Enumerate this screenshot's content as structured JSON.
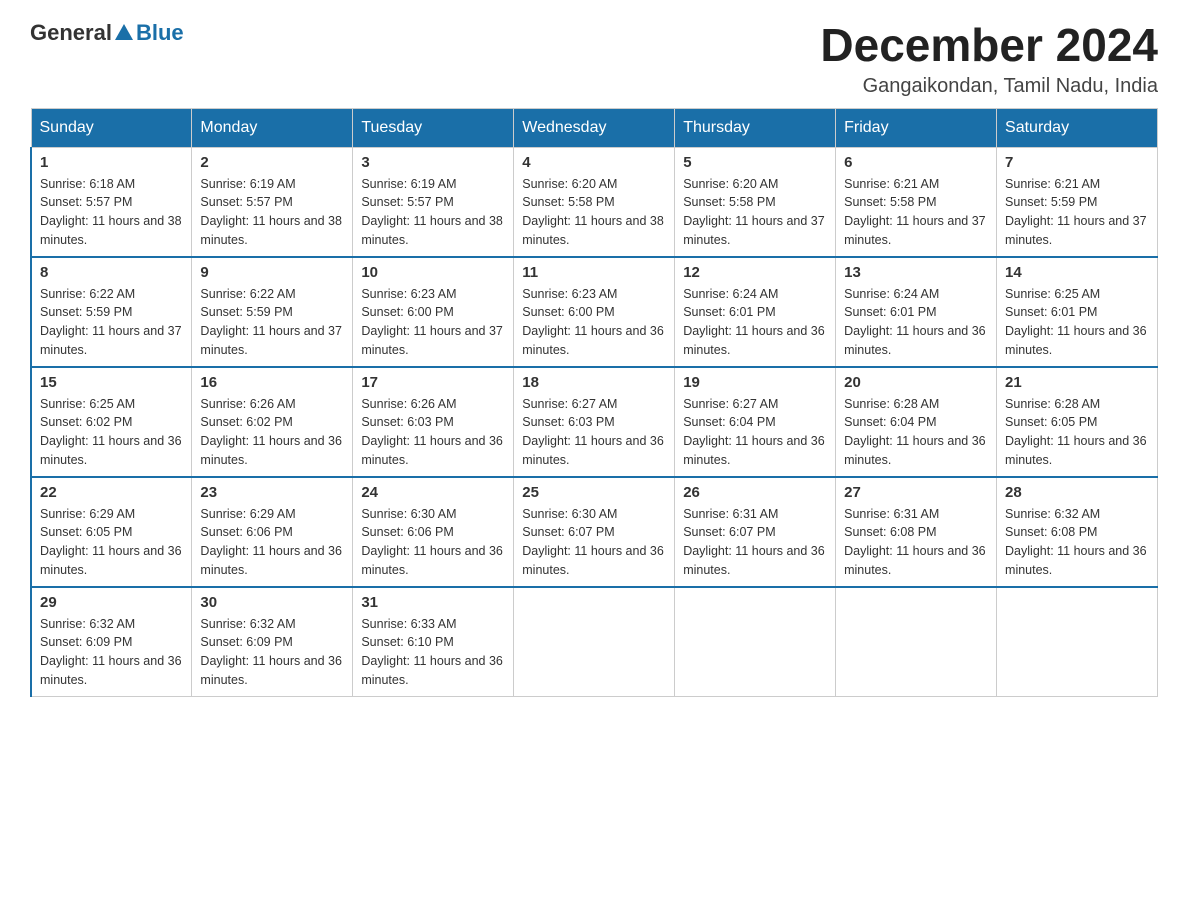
{
  "header": {
    "logo_general": "General",
    "logo_blue": "Blue",
    "title": "December 2024",
    "location": "Gangaikondan, Tamil Nadu, India"
  },
  "days_of_week": [
    "Sunday",
    "Monday",
    "Tuesday",
    "Wednesday",
    "Thursday",
    "Friday",
    "Saturday"
  ],
  "weeks": [
    [
      {
        "date": "1",
        "sunrise": "6:18 AM",
        "sunset": "5:57 PM",
        "daylight": "11 hours and 38 minutes."
      },
      {
        "date": "2",
        "sunrise": "6:19 AM",
        "sunset": "5:57 PM",
        "daylight": "11 hours and 38 minutes."
      },
      {
        "date": "3",
        "sunrise": "6:19 AM",
        "sunset": "5:57 PM",
        "daylight": "11 hours and 38 minutes."
      },
      {
        "date": "4",
        "sunrise": "6:20 AM",
        "sunset": "5:58 PM",
        "daylight": "11 hours and 38 minutes."
      },
      {
        "date": "5",
        "sunrise": "6:20 AM",
        "sunset": "5:58 PM",
        "daylight": "11 hours and 37 minutes."
      },
      {
        "date": "6",
        "sunrise": "6:21 AM",
        "sunset": "5:58 PM",
        "daylight": "11 hours and 37 minutes."
      },
      {
        "date": "7",
        "sunrise": "6:21 AM",
        "sunset": "5:59 PM",
        "daylight": "11 hours and 37 minutes."
      }
    ],
    [
      {
        "date": "8",
        "sunrise": "6:22 AM",
        "sunset": "5:59 PM",
        "daylight": "11 hours and 37 minutes."
      },
      {
        "date": "9",
        "sunrise": "6:22 AM",
        "sunset": "5:59 PM",
        "daylight": "11 hours and 37 minutes."
      },
      {
        "date": "10",
        "sunrise": "6:23 AM",
        "sunset": "6:00 PM",
        "daylight": "11 hours and 37 minutes."
      },
      {
        "date": "11",
        "sunrise": "6:23 AM",
        "sunset": "6:00 PM",
        "daylight": "11 hours and 36 minutes."
      },
      {
        "date": "12",
        "sunrise": "6:24 AM",
        "sunset": "6:01 PM",
        "daylight": "11 hours and 36 minutes."
      },
      {
        "date": "13",
        "sunrise": "6:24 AM",
        "sunset": "6:01 PM",
        "daylight": "11 hours and 36 minutes."
      },
      {
        "date": "14",
        "sunrise": "6:25 AM",
        "sunset": "6:01 PM",
        "daylight": "11 hours and 36 minutes."
      }
    ],
    [
      {
        "date": "15",
        "sunrise": "6:25 AM",
        "sunset": "6:02 PM",
        "daylight": "11 hours and 36 minutes."
      },
      {
        "date": "16",
        "sunrise": "6:26 AM",
        "sunset": "6:02 PM",
        "daylight": "11 hours and 36 minutes."
      },
      {
        "date": "17",
        "sunrise": "6:26 AM",
        "sunset": "6:03 PM",
        "daylight": "11 hours and 36 minutes."
      },
      {
        "date": "18",
        "sunrise": "6:27 AM",
        "sunset": "6:03 PM",
        "daylight": "11 hours and 36 minutes."
      },
      {
        "date": "19",
        "sunrise": "6:27 AM",
        "sunset": "6:04 PM",
        "daylight": "11 hours and 36 minutes."
      },
      {
        "date": "20",
        "sunrise": "6:28 AM",
        "sunset": "6:04 PM",
        "daylight": "11 hours and 36 minutes."
      },
      {
        "date": "21",
        "sunrise": "6:28 AM",
        "sunset": "6:05 PM",
        "daylight": "11 hours and 36 minutes."
      }
    ],
    [
      {
        "date": "22",
        "sunrise": "6:29 AM",
        "sunset": "6:05 PM",
        "daylight": "11 hours and 36 minutes."
      },
      {
        "date": "23",
        "sunrise": "6:29 AM",
        "sunset": "6:06 PM",
        "daylight": "11 hours and 36 minutes."
      },
      {
        "date": "24",
        "sunrise": "6:30 AM",
        "sunset": "6:06 PM",
        "daylight": "11 hours and 36 minutes."
      },
      {
        "date": "25",
        "sunrise": "6:30 AM",
        "sunset": "6:07 PM",
        "daylight": "11 hours and 36 minutes."
      },
      {
        "date": "26",
        "sunrise": "6:31 AM",
        "sunset": "6:07 PM",
        "daylight": "11 hours and 36 minutes."
      },
      {
        "date": "27",
        "sunrise": "6:31 AM",
        "sunset": "6:08 PM",
        "daylight": "11 hours and 36 minutes."
      },
      {
        "date": "28",
        "sunrise": "6:32 AM",
        "sunset": "6:08 PM",
        "daylight": "11 hours and 36 minutes."
      }
    ],
    [
      {
        "date": "29",
        "sunrise": "6:32 AM",
        "sunset": "6:09 PM",
        "daylight": "11 hours and 36 minutes."
      },
      {
        "date": "30",
        "sunrise": "6:32 AM",
        "sunset": "6:09 PM",
        "daylight": "11 hours and 36 minutes."
      },
      {
        "date": "31",
        "sunrise": "6:33 AM",
        "sunset": "6:10 PM",
        "daylight": "11 hours and 36 minutes."
      },
      null,
      null,
      null,
      null
    ]
  ],
  "labels": {
    "sunrise_prefix": "Sunrise: ",
    "sunset_prefix": "Sunset: ",
    "daylight_prefix": "Daylight: "
  }
}
